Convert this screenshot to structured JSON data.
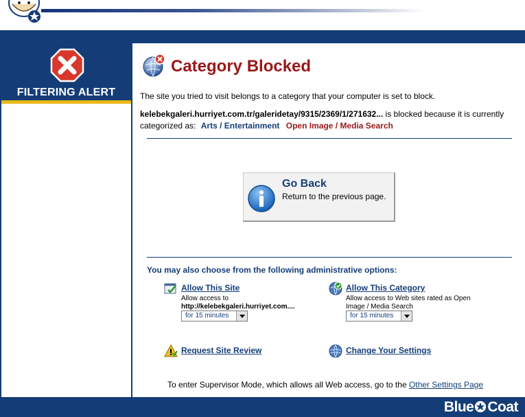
{
  "sidebar": {
    "alert_label": "FILTERING ALERT"
  },
  "main": {
    "title": "Category Blocked",
    "intro": "The site you tried to visit belongs to a category that your computer is set to block.",
    "blocked_url": "kelebekgaleri.hurriyet.com.tr/galeridetay/9315/2369/1/271632...",
    "blocked_text": " is blocked because it is currently categorized as:",
    "categories": [
      "Arts / Entertainment",
      "Open Image / Media Search"
    ]
  },
  "go_back": {
    "title": "Go Back",
    "subtitle": "Return to the previous page."
  },
  "admin": {
    "heading": "You may also choose from the following administrative options:",
    "allow_site": {
      "label": "Allow This Site",
      "desc": "Allow access to",
      "url": "http://kelebekgaleri.hurriyet.com....",
      "duration": "for 15 minutes"
    },
    "allow_category": {
      "label": "Allow This Category",
      "desc": "Allow access to Web sites rated as Open Image / Media Search",
      "duration": "for 15 minutes"
    },
    "request_review": {
      "label": "Request Site Review"
    },
    "change_settings": {
      "label": "Change Your Settings"
    }
  },
  "supervisor": {
    "text": "To enter Supervisor Mode, which allows all Web access, go to the ",
    "link": "Other Settings Page"
  },
  "footer": {
    "brand_left": "Blue",
    "brand_right": "Coat"
  },
  "colors": {
    "navy": "#143d77",
    "title_red": "#991818",
    "accent_gold": "#e8b917",
    "alert_red": "#d9372b"
  }
}
